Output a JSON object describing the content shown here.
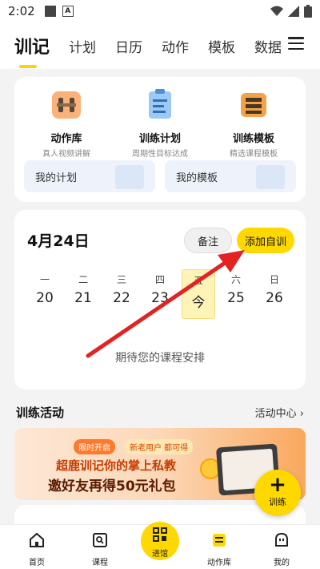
{
  "status_bar": {
    "time": "2:02"
  },
  "top_nav": {
    "tabs": [
      {
        "label": "训记"
      },
      {
        "label": "计划"
      },
      {
        "label": "日历"
      },
      {
        "label": "动作"
      },
      {
        "label": "模板"
      },
      {
        "label": "数据"
      }
    ],
    "active_tab": "训记"
  },
  "tools": [
    {
      "title": "动作库",
      "subtitle": "真人视频讲解"
    },
    {
      "title": "训练计划",
      "subtitle": "周期性目标达成"
    },
    {
      "title": "训练模板",
      "subtitle": "精选课程模板"
    }
  ],
  "tiles": {
    "my_plan": "我的计划",
    "my_template": "我的模板"
  },
  "calendar": {
    "date_title": "4月24日",
    "note_button": "备注",
    "add_button": "添加自训",
    "days": [
      {
        "weekday": "一",
        "date": "20"
      },
      {
        "weekday": "二",
        "date": "21"
      },
      {
        "weekday": "三",
        "date": "22"
      },
      {
        "weekday": "四",
        "date": "23"
      },
      {
        "weekday": "五",
        "date": "今"
      },
      {
        "weekday": "六",
        "date": "25"
      },
      {
        "weekday": "日",
        "date": "26"
      }
    ],
    "empty_text": "期待您的课程安排"
  },
  "activities": {
    "title": "训练活动",
    "link": "活动中心 ›"
  },
  "banner": {
    "tag1": "限时开启",
    "tag2": "新老用户 都可得",
    "line1": "超鹿训记你的掌上私教",
    "line2": "邀好友再得50元礼包"
  },
  "fab": {
    "icon": "plus-icon",
    "label": "训练"
  },
  "bottom_nav": {
    "items": [
      {
        "label": "首页"
      },
      {
        "label": "课程"
      },
      {
        "label": "进馆"
      },
      {
        "label": "动作库"
      },
      {
        "label": "我的"
      }
    ]
  },
  "colors": {
    "accent": "#ffd800",
    "arrow": "#e32222"
  }
}
